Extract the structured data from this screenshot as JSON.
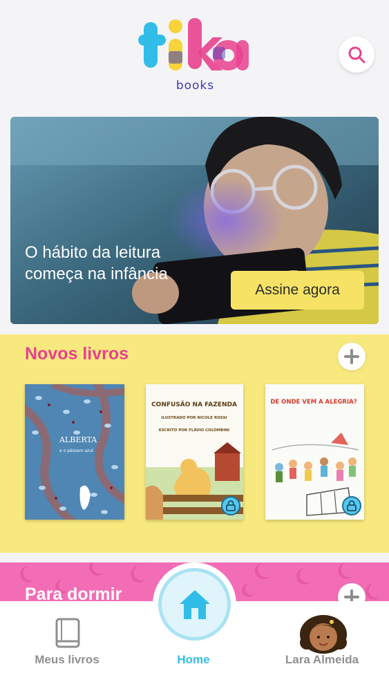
{
  "app": {
    "logo_text": "tika",
    "logo_sub": "books"
  },
  "hero": {
    "text": "O hábito da leitura começa na infância",
    "cta_label": "Assine agora"
  },
  "sections": [
    {
      "title": "Novos livros",
      "books": [
        {
          "title": "ALBERTA",
          "subtitle": "e o pássaro azul",
          "locked": false
        },
        {
          "title": "CONFUSÃO NA FAZENDA",
          "illustrator": "ILUSTRADO POR NICOLE ROSSI",
          "author": "ESCRITO POR FLÁVIO COLOMBINI",
          "locked": true
        },
        {
          "title": "DE ONDE VEM A ALEGRIA?",
          "locked": true
        }
      ]
    },
    {
      "title": "Para dormir"
    }
  ],
  "bottom_nav": [
    {
      "label": "Meus livros",
      "icon": "book-icon",
      "active": false
    },
    {
      "label": "Home",
      "icon": "home-icon",
      "active": true
    },
    {
      "label": "Lara Almeida",
      "icon": "avatar",
      "active": false
    }
  ],
  "colors": {
    "brand_pink": "#e9418e",
    "brand_cyan": "#32bde9",
    "brand_yellow": "#f8e97e",
    "sleep_pink": "#f36db6",
    "cta_yellow": "#f6e366"
  }
}
